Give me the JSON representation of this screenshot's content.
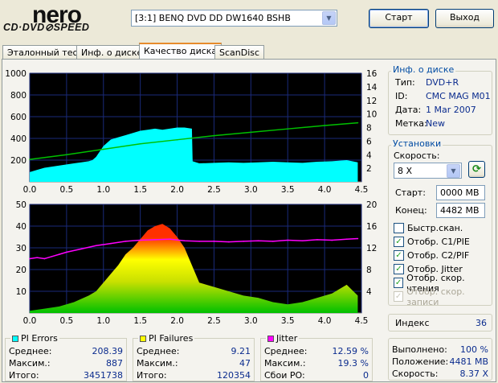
{
  "app": {
    "logo_main": "nero",
    "logo_sub": "CD·DVD⊘SPEED"
  },
  "toolbar": {
    "drive_value": "[3:1]  BENQ DVD DD DW1640 BSHB",
    "start_label": "Старт",
    "exit_label": "Выход"
  },
  "tabs": [
    {
      "label": "Эталонный тест"
    },
    {
      "label": "Инф. о диске"
    },
    {
      "label": "Качество диска",
      "active": true
    },
    {
      "label": "ScanDisc"
    }
  ],
  "disc_info": {
    "title": "Инф. о диске",
    "rows": [
      {
        "key": "Тип:",
        "value": "DVD+R"
      },
      {
        "key": "ID:",
        "value": "CMC MAG M01"
      },
      {
        "key": "Дата:",
        "value": "1 Mar 2007"
      },
      {
        "key": "Метка:",
        "value": "New"
      }
    ]
  },
  "settings": {
    "title": "Установки",
    "speed_label": "Скорость:",
    "speed_value": "8 X",
    "start_label": "Старт:",
    "start_value": "0000 MB",
    "end_label": "Конец:",
    "end_value": "4482 MB",
    "checkboxes": [
      {
        "label": "Быстр.скан.",
        "checked": false,
        "disabled": false
      },
      {
        "label": "Отобр. C1/PIE",
        "checked": true,
        "disabled": false
      },
      {
        "label": "Отобр. C2/PIF",
        "checked": true,
        "disabled": false
      },
      {
        "label": "Отобр. Jitter",
        "checked": true,
        "disabled": false
      },
      {
        "label": "Отобр. скор. чтения",
        "checked": true,
        "disabled": false
      },
      {
        "label": "Отобр. скор. записи",
        "checked": true,
        "disabled": true
      }
    ]
  },
  "index": {
    "label": "Индекс",
    "value": "36"
  },
  "progress": {
    "rows": [
      {
        "key": "Выполнено:",
        "value": "100 %"
      },
      {
        "key": "Положение:",
        "value": "4481 MB"
      },
      {
        "key": "Скорость:",
        "value": "8.37 X"
      }
    ]
  },
  "stats": {
    "pi_errors": {
      "title": "PI Errors",
      "color": "#00ffff",
      "rows": [
        {
          "key": "Среднее:",
          "value": "208.39"
        },
        {
          "key": "Максим.:",
          "value": "887"
        },
        {
          "key": "Итого:",
          "value": "3451738"
        }
      ]
    },
    "pi_failures": {
      "title": "PI Failures",
      "color": "#ffff00",
      "rows": [
        {
          "key": "Среднее:",
          "value": "9.21"
        },
        {
          "key": "Максим.:",
          "value": "47"
        },
        {
          "key": "Итого:",
          "value": "120354"
        }
      ]
    },
    "jitter": {
      "title": "Jitter",
      "color": "#ff00ff",
      "rows": [
        {
          "key": "Среднее:",
          "value": "12.59 %"
        },
        {
          "key": "Максим.:",
          "value": "19.3 %"
        },
        {
          "key": "Сбои PO:",
          "value": "0"
        }
      ]
    }
  },
  "chart_data": [
    {
      "type": "area",
      "xlim": [
        0,
        4.5
      ],
      "ylim": [
        0,
        1000
      ],
      "y2lim": [
        0,
        16
      ],
      "x_ticks": [
        "0.0",
        "0.5",
        "1.0",
        "1.5",
        "2.0",
        "2.5",
        "3.0",
        "3.5",
        "4.0",
        "4.5"
      ],
      "y_ticks": [
        "200",
        "400",
        "600",
        "800",
        "1000"
      ],
      "y2_ticks": [
        "2",
        "4",
        "6",
        "8",
        "10",
        "12",
        "14",
        "16"
      ],
      "grid": true,
      "series": [
        {
          "name": "PI Errors",
          "color": "#00ffff",
          "x": [
            0.0,
            0.1,
            0.2,
            0.3,
            0.4,
            0.5,
            0.6,
            0.7,
            0.8,
            0.85,
            0.9,
            1.0,
            1.1,
            1.2,
            1.3,
            1.4,
            1.5,
            1.6,
            1.7,
            1.8,
            1.9,
            2.0,
            2.1,
            2.2,
            2.21,
            2.3,
            2.5,
            2.7,
            2.9,
            3.1,
            3.3,
            3.5,
            3.7,
            3.9,
            4.1,
            4.3,
            4.45
          ],
          "y": [
            90,
            110,
            130,
            140,
            150,
            160,
            170,
            180,
            190,
            200,
            230,
            330,
            390,
            410,
            430,
            450,
            470,
            480,
            490,
            480,
            490,
            500,
            500,
            490,
            190,
            170,
            175,
            180,
            175,
            180,
            185,
            180,
            175,
            185,
            190,
            200,
            180
          ]
        },
        {
          "name": "Read speed",
          "color": "#00c000",
          "axis": "y2",
          "x": [
            0.0,
            0.5,
            1.0,
            1.5,
            2.0,
            2.5,
            3.0,
            3.5,
            4.0,
            4.45
          ],
          "y": [
            3.3,
            4.0,
            4.8,
            5.6,
            6.2,
            6.8,
            7.3,
            7.8,
            8.3,
            8.7
          ]
        }
      ]
    },
    {
      "type": "area",
      "xlim": [
        0,
        4.5
      ],
      "ylim": [
        0,
        50
      ],
      "y2lim": [
        0,
        20
      ],
      "x_ticks": [
        "0.0",
        "0.5",
        "1.0",
        "1.5",
        "2.0",
        "2.5",
        "3.0",
        "3.5",
        "4.0",
        "4.5"
      ],
      "y_ticks": [
        "10",
        "20",
        "30",
        "40",
        "50"
      ],
      "y2_ticks": [
        "4",
        "8",
        "12",
        "16",
        "20"
      ],
      "grid": true,
      "series": [
        {
          "name": "PI Failures",
          "color": "#ffff00",
          "x": [
            0.0,
            0.2,
            0.4,
            0.6,
            0.8,
            0.9,
            1.0,
            1.1,
            1.2,
            1.3,
            1.4,
            1.5,
            1.6,
            1.7,
            1.8,
            1.9,
            2.0,
            2.1,
            2.2,
            2.3,
            2.5,
            2.7,
            2.9,
            3.1,
            3.3,
            3.5,
            3.7,
            3.9,
            4.1,
            4.3,
            4.45
          ],
          "y": [
            1,
            2,
            3,
            5,
            8,
            10,
            14,
            18,
            22,
            27,
            30,
            34,
            38,
            40,
            41,
            39,
            35,
            30,
            22,
            14,
            12,
            10,
            8,
            7,
            5,
            4,
            5,
            7,
            9,
            13,
            8
          ]
        },
        {
          "name": "Jitter",
          "color": "#ff00ff",
          "axis": "y2",
          "x": [
            0.0,
            0.1,
            0.2,
            0.3,
            0.4,
            0.5,
            0.7,
            0.9,
            1.1,
            1.3,
            1.5,
            1.7,
            1.9,
            2.1,
            2.3,
            2.5,
            2.7,
            2.9,
            3.1,
            3.3,
            3.5,
            3.7,
            3.9,
            4.1,
            4.3,
            4.45
          ],
          "y": [
            10.0,
            10.2,
            10.0,
            10.4,
            10.8,
            11.2,
            11.8,
            12.4,
            12.8,
            13.2,
            13.4,
            13.5,
            13.6,
            13.3,
            13.2,
            13.2,
            13.1,
            13.2,
            13.3,
            13.2,
            13.4,
            13.3,
            13.5,
            13.4,
            13.6,
            13.7
          ]
        }
      ]
    }
  ]
}
